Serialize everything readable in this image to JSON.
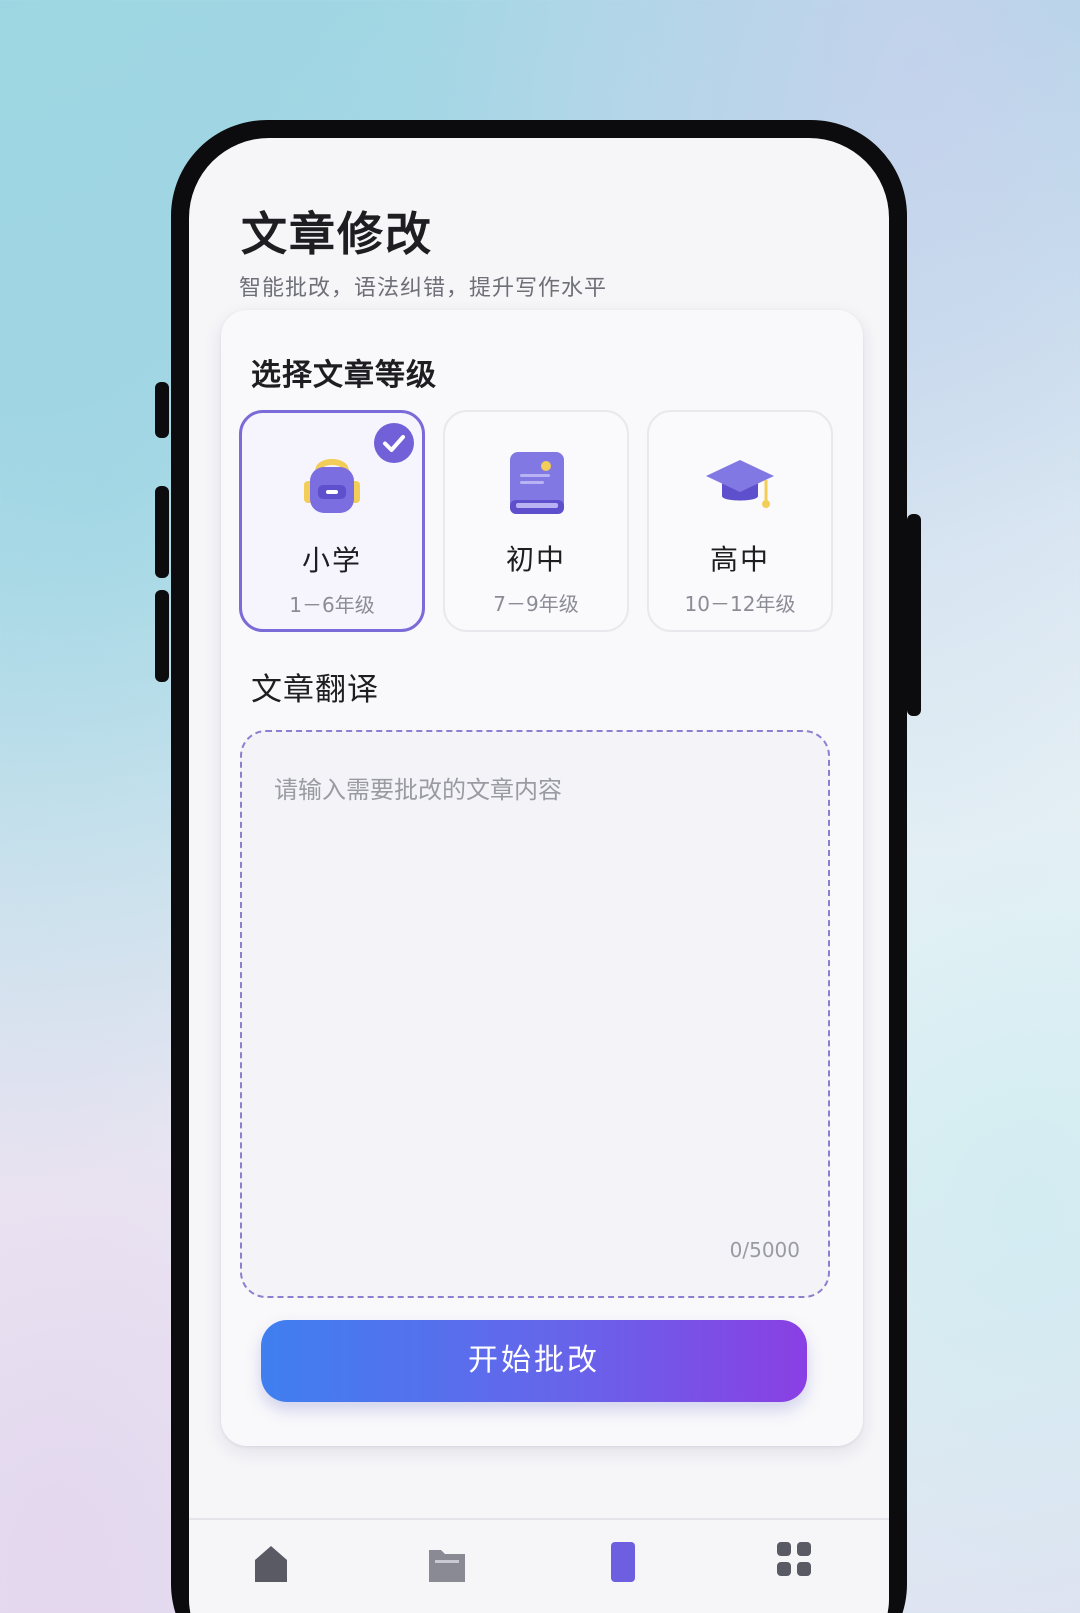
{
  "header": {
    "title": "文章修改",
    "subtitle": "智能批改，语法纠错，提升写作水平"
  },
  "level_section": {
    "title": "选择文章等级",
    "selected": "小学",
    "levels": [
      {
        "name": "小学",
        "range": "1－6年级",
        "icon": "backpack-icon"
      },
      {
        "name": "初中",
        "range": "7－9年级",
        "icon": "book-icon"
      },
      {
        "name": "高中",
        "range": "10－12年级",
        "icon": "graduation-cap-icon"
      }
    ]
  },
  "input_section": {
    "title": "文章翻译",
    "placeholder": "请输入需要批改的文章内容",
    "value": "",
    "counter": "0/5000"
  },
  "submit": {
    "label": "开始批改"
  },
  "tabbar": {
    "items": [
      {
        "icon": "home-icon",
        "active": false
      },
      {
        "icon": "folder-icon",
        "active": false
      },
      {
        "icon": "edit-icon",
        "active": true
      },
      {
        "icon": "grid-icon",
        "active": false
      }
    ]
  },
  "colors": {
    "accent": "#7160d8",
    "button_start": "#3f7ff0",
    "button_end": "#8a3fe4",
    "text_primary": "#1e1e22",
    "text_secondary": "#8c8c96"
  }
}
